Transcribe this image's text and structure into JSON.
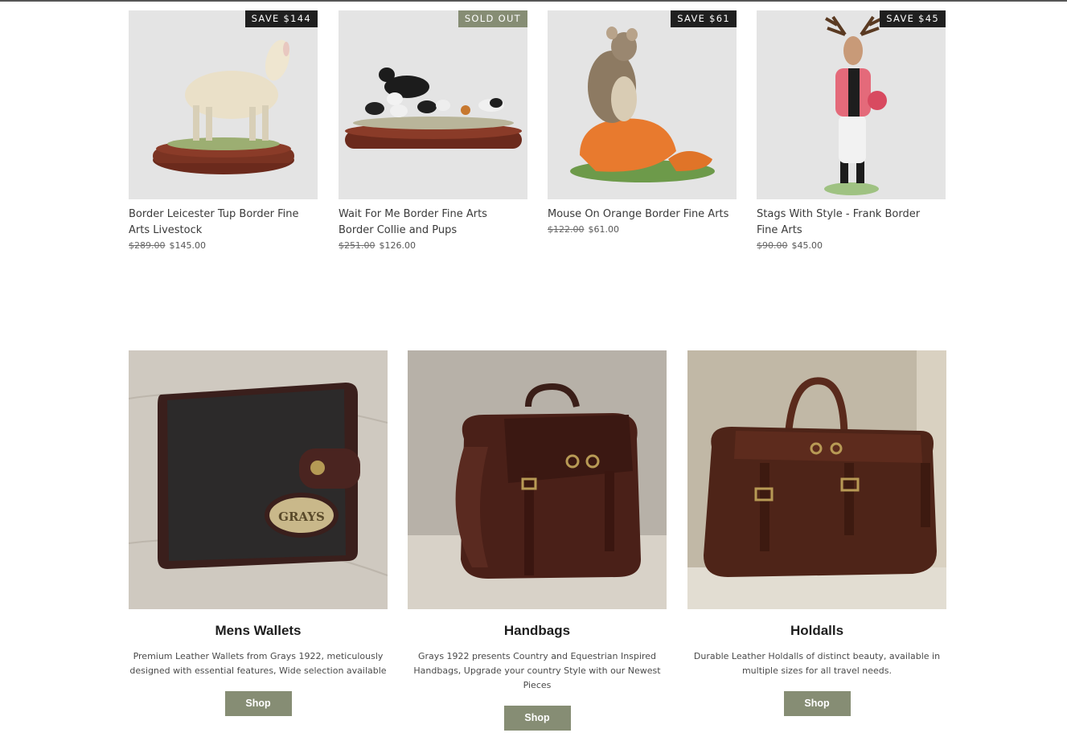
{
  "products": [
    {
      "title": "Border Leicester Tup Border Fine Arts Livestock",
      "badge": "SAVE $144",
      "was_price": "$289.00",
      "price": "$145.00"
    },
    {
      "title": "Wait For Me Border Fine Arts Border Collie and Pups",
      "badge": "SOLD OUT",
      "was_price": "$251.00",
      "price": "$126.00"
    },
    {
      "title": "Mouse On Orange Border Fine Arts",
      "badge": "SAVE $61",
      "was_price": "$122.00",
      "price": "$61.00"
    },
    {
      "title": "Stags With Style - Frank Border Fine Arts",
      "badge": "SAVE $45",
      "was_price": "$90.00",
      "price": "$45.00"
    }
  ],
  "collections": [
    {
      "title": "Mens Wallets",
      "description": "Premium Leather Wallets from Grays 1922, meticulously designed with essential features, Wide selection available",
      "button": "Shop",
      "emblem_text": "GRAYS"
    },
    {
      "title": "Handbags",
      "description": "Grays 1922 presents Country and Equestrian Inspired Handbags, Upgrade your country Style with our Newest Pieces",
      "button": "Shop"
    },
    {
      "title": "Holdalls",
      "description": "Durable Leather Holdalls of distinct beauty, available in multiple sizes for all travel needs.",
      "button": "Shop"
    }
  ],
  "colors": {
    "accent": "#868d74",
    "badge_dark": "#1f1f1f",
    "thumb_bg": "#e4e4e4"
  }
}
